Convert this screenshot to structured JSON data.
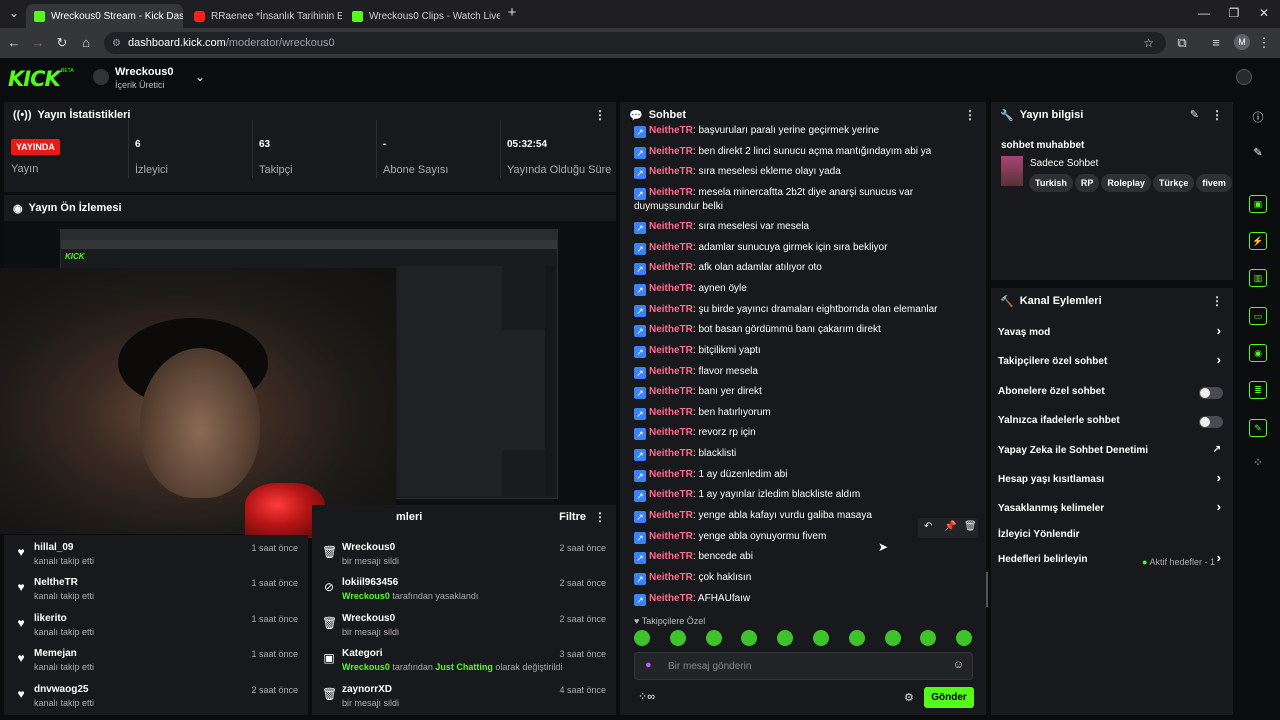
{
  "browser": {
    "tabs": [
      {
        "title": "Wreckous0 Stream - Kick Dashb",
        "icon": "kick-favicon"
      },
      {
        "title": "RRaenee *İnsanlık Tarihinin En",
        "icon": "youtube-favicon"
      },
      {
        "title": "Wreckous0 Clips - Watch Live c",
        "icon": "kick-favicon"
      }
    ],
    "url_host": "dashboard.kick.com",
    "url_path": "/moderator/wreckous0",
    "profile_initial": "M"
  },
  "header": {
    "logo": "KICK",
    "beta": "BETA",
    "user": "Wreckous0",
    "role": "İçerik Üretici"
  },
  "stats": {
    "title": "Yayın İstatistikleri",
    "live_badge": "YAYINDA",
    "live_label": "Yayın",
    "items": [
      {
        "value": "6",
        "label": "İzleyici"
      },
      {
        "value": "63",
        "label": "Takipçi"
      },
      {
        "value": "-",
        "label": "Abone Sayısı"
      },
      {
        "value": "05:32:54",
        "label": "Yayında Olduğu Süre"
      }
    ]
  },
  "preview": {
    "title": "Yayın Ön İzlemesi"
  },
  "activity": {
    "items": [
      {
        "name": "hillal_09",
        "sub": "kanalı takip etti",
        "time": "1 saat önce"
      },
      {
        "name": "NeltheTR",
        "sub": "kanalı takip etti",
        "time": "1 saat önce"
      },
      {
        "name": "likerito",
        "sub": "kanalı takip etti",
        "time": "1 saat önce"
      },
      {
        "name": "Memejan",
        "sub": "kanalı takip etti",
        "time": "1 saat önce"
      },
      {
        "name": "dnvwaog25",
        "sub": "kanalı takip etti",
        "time": "2 saat önce"
      }
    ]
  },
  "modlog": {
    "title_partial": "mleri",
    "filter": "Filtre",
    "items": [
      {
        "name": "Wreckous0",
        "pre": "",
        "actor": "",
        "mid": "bir mesajı sildi",
        "tag": "",
        "post": "",
        "time": "2 saat önce",
        "icon": "trash-icon"
      },
      {
        "name": "lokiil963456",
        "pre": "",
        "actor": "Wreckous0",
        "mid": " tarafından yasaklandı",
        "tag": "",
        "post": "",
        "time": "2 saat önce",
        "icon": "ban-icon"
      },
      {
        "name": "Wreckous0",
        "pre": "",
        "actor": "",
        "mid": "bir mesajı sildi",
        "tag": "",
        "post": "",
        "time": "2 saat önce",
        "icon": "trash-icon"
      },
      {
        "name": "Kategori",
        "pre": "",
        "actor": "Wreckous0",
        "mid": " tarafından ",
        "tag": "Just Chatting",
        "post": " olarak değiştirildi",
        "time": "3 saat önce",
        "icon": "category-icon"
      },
      {
        "name": "zaynorrXD",
        "pre": "",
        "actor": "",
        "mid": "bir mesajı sildi",
        "tag": "",
        "post": "",
        "time": "4 saat önce",
        "icon": "trash-icon"
      }
    ]
  },
  "chat": {
    "title": "Sohbet",
    "messages": [
      {
        "user": "NeitheTR",
        "text": "başvuruları paralı yerine geçirmek yerine"
      },
      {
        "user": "NeitheTR",
        "text": "ben direkt 2 linci sunucu açma mantığındayım abi ya"
      },
      {
        "user": "NeitheTR",
        "text": "sıra meselesi ekleme olayı yada"
      },
      {
        "user": "NeitheTR",
        "text": "mesela minercaftta 2b2t diye anarşi sunucus var duymuşsundur belki"
      },
      {
        "user": "NeitheTR",
        "text": "sıra meselesi var mesela"
      },
      {
        "user": "NeitheTR",
        "text": "adamlar sunucuya girmek için sıra bekliyor"
      },
      {
        "user": "NeitheTR",
        "text": "afk olan adamlar atılıyor oto"
      },
      {
        "user": "NeitheTR",
        "text": "aynen öyle"
      },
      {
        "user": "NeitheTR",
        "text": "şu birde yayıncı dramaları eightbornda olan elemanlar"
      },
      {
        "user": "NeitheTR",
        "text": "bot basan gördümmü banı çakarım direkt"
      },
      {
        "user": "NeitheTR",
        "text": "bitçilikmi yaptı"
      },
      {
        "user": "NeitheTR",
        "text": "flavor mesela"
      },
      {
        "user": "NeitheTR",
        "text": "banı yer direkt"
      },
      {
        "user": "NeitheTR",
        "text": "ben hatırlıyorum"
      },
      {
        "user": "NeitheTR",
        "text": "revorz rp için"
      },
      {
        "user": "NeitheTR",
        "text": "blacklisti"
      },
      {
        "user": "NeitheTR",
        "text": "1 ay düzenledim abi"
      },
      {
        "user": "NeitheTR",
        "text": "1 ay yayınlar izledim blackliste aldım"
      },
      {
        "user": "NeitheTR",
        "text": "yenge abla kafayı vurdu galiba masaya"
      },
      {
        "user": "NeitheTR",
        "text": "yenge abla oynuyormu fivem"
      },
      {
        "user": "NeitheTR",
        "text": "bencede abi"
      },
      {
        "user": "NeitheTR",
        "text": "çok haklısın"
      },
      {
        "user": "NeitheTR",
        "text": "AFHAUfaıw"
      }
    ],
    "mode_label": "Takipçilere Özel",
    "placeholder": "Bir mesaj gönderin",
    "send": "Gönder"
  },
  "stream_info": {
    "title": "Yayın bilgisi",
    "stream_title": "sohbet muhabbet",
    "category": "Sadece Sohbet",
    "tags": [
      "Turkish",
      "RP",
      "Roleplay",
      "Türkçe",
      "fivem"
    ]
  },
  "channel_actions": {
    "title": "Kanal Eylemleri",
    "items": [
      {
        "label": "Yavaş mod",
        "control": "chevron"
      },
      {
        "label": "Takipçilere özel sohbet",
        "control": "chevron"
      },
      {
        "label": "Abonelere özel sohbet",
        "control": "toggle"
      },
      {
        "label": "Yalnızca ifadelerle sohbet",
        "control": "toggle"
      },
      {
        "label": "Yapay Zeka ile Sohbet Denetimi",
        "control": "external"
      },
      {
        "label": "Hesap yaşı kısıtlaması",
        "control": "chevron"
      },
      {
        "label": "Yasaklanmış kelimeler",
        "control": "chevron"
      },
      {
        "label": "İzleyici Yönlendir",
        "control": "none"
      },
      {
        "label": "Hedefleri belirleyin",
        "control": "chevron"
      }
    ],
    "goals_status": "Aktif hedefler - 1"
  }
}
